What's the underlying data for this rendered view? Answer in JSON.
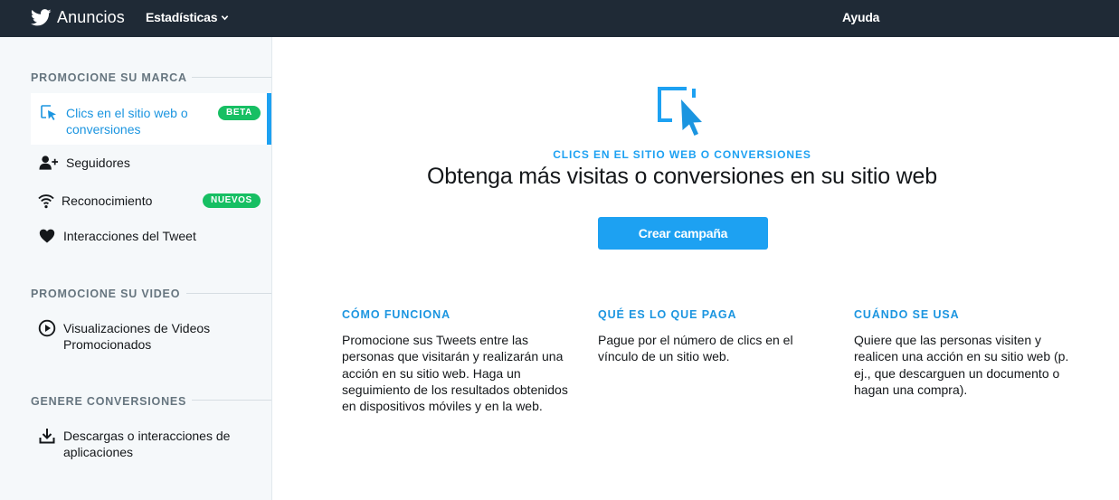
{
  "topbar": {
    "brand": "Anuncios",
    "stats_menu": "Estadísticas",
    "help": "Ayuda",
    "icons": {
      "logo": "twitter-bird-icon",
      "dropdown": "chevron-down-icon"
    }
  },
  "sidebar": {
    "sections": [
      {
        "title": "PROMOCIONE SU MARCA",
        "items": [
          {
            "label": "Clics en el sitio web o conversiones",
            "icon": "cursor-click-icon",
            "badge": "BETA",
            "active": true
          },
          {
            "label": "Seguidores",
            "icon": "add-user-icon"
          },
          {
            "label": "Reconocimiento",
            "icon": "wifi-signal-icon",
            "badge": "NUEVOS"
          },
          {
            "label": "Interacciones del Tweet",
            "icon": "heart-icon"
          }
        ]
      },
      {
        "title": "PROMOCIONE SU VIDEO",
        "items": [
          {
            "label": "Visualizaciones de Videos Promocionados",
            "icon": "play-circle-icon"
          }
        ]
      },
      {
        "title": "GENERE CONVERSIONES",
        "items": [
          {
            "label": "Descargas o interacciones de aplicaciones",
            "icon": "download-icon"
          }
        ]
      }
    ]
  },
  "main": {
    "hero_icon": "website-click-icon",
    "eyebrow": "CLICS EN EL SITIO WEB O CONVERSIONES",
    "headline": "Obtenga más visitas o conversiones en su sitio web",
    "cta_label": "Crear campaña",
    "info": [
      {
        "title": "CÓMO FUNCIONA",
        "body": "Promocione sus Tweets entre las personas que visitarán y realizarán una acción en su sitio web. Haga un seguimiento de los resultados obtenidos en dispositivos móviles y en la web."
      },
      {
        "title": "QUÉ ES LO QUE PAGA",
        "body": "Pague por el número de clics en el vínculo de un sitio web."
      },
      {
        "title": "CUÁNDO SE USA",
        "body": "Quiere que las personas visiten y realicen una acción en su sitio web (p. ej., que descarguen un documento o hagan una compra)."
      }
    ]
  },
  "colors": {
    "topbar_bg": "#1f2a36",
    "accent": "#1da1f2",
    "active_text": "#1b95e0",
    "badge_green": "#17bf63",
    "sidebar_bg": "#f5f8fa"
  }
}
